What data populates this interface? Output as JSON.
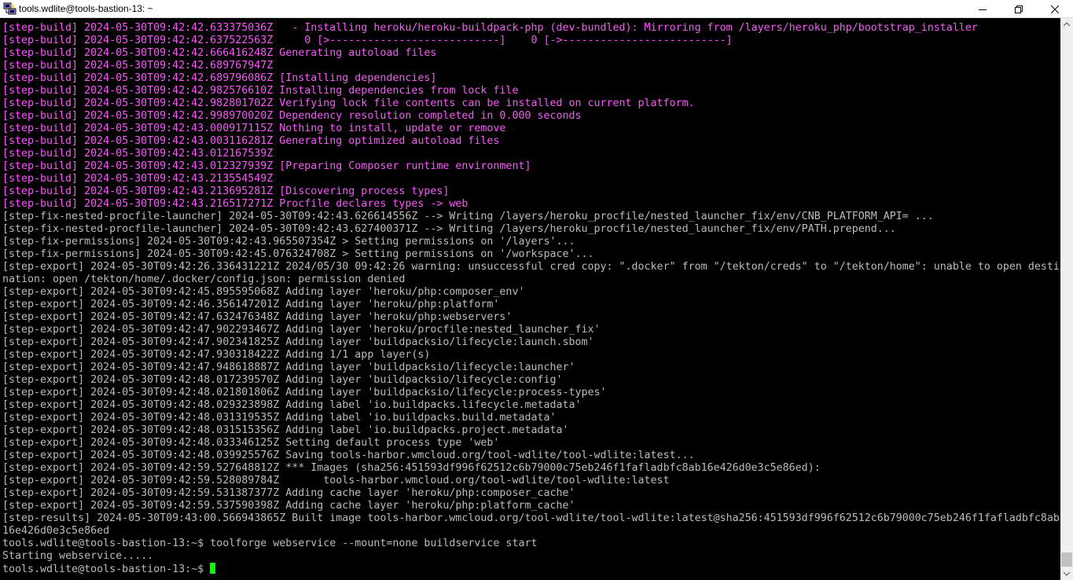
{
  "window": {
    "title": "tools.wdlite@tools-bastion-13: ~",
    "icons": {
      "app": "putty-icon",
      "minimize": "minimize-icon",
      "maximize": "maximize-icon",
      "close": "close-icon"
    }
  },
  "colors": {
    "background": "#000000",
    "text_default": "#bbbbbb",
    "text_magenta": "#ff55ff",
    "cursor": "#00ff00"
  },
  "terminal": {
    "lines": [
      {
        "text": "[step-build] 2024-05-30T09:42:42.633375036Z   - Installing heroku/heroku-buildpack-php (dev-bundled): Mirroring from /layers/heroku_php/bootstrap_installer",
        "color": "magenta"
      },
      {
        "text": "[step-build] 2024-05-30T09:42:42.637522563Z     0 [>---------------------------]    0 [->--------------------------]",
        "color": "magenta"
      },
      {
        "text": "[step-build] 2024-05-30T09:42:42.666416248Z Generating autoload files",
        "color": "magenta"
      },
      {
        "text": "[step-build] 2024-05-30T09:42:42.689767947Z",
        "color": "magenta"
      },
      {
        "text": "[step-build] 2024-05-30T09:42:42.689796086Z [Installing dependencies]",
        "color": "magenta"
      },
      {
        "text": "[step-build] 2024-05-30T09:42:42.982576610Z Installing dependencies from lock file",
        "color": "magenta"
      },
      {
        "text": "[step-build] 2024-05-30T09:42:42.982801702Z Verifying lock file contents can be installed on current platform.",
        "color": "magenta"
      },
      {
        "text": "[step-build] 2024-05-30T09:42:42.998970020Z Dependency resolution completed in 0.000 seconds",
        "color": "magenta"
      },
      {
        "text": "[step-build] 2024-05-30T09:42:43.000917115Z Nothing to install, update or remove",
        "color": "magenta"
      },
      {
        "text": "[step-build] 2024-05-30T09:42:43.003116281Z Generating optimized autoload files",
        "color": "magenta"
      },
      {
        "text": "[step-build] 2024-05-30T09:42:43.012167539Z",
        "color": "magenta"
      },
      {
        "text": "[step-build] 2024-05-30T09:42:43.012327939Z [Preparing Composer runtime environment]",
        "color": "magenta"
      },
      {
        "text": "[step-build] 2024-05-30T09:42:43.213554549Z",
        "color": "magenta"
      },
      {
        "text": "[step-build] 2024-05-30T09:42:43.213695281Z [Discovering process types]",
        "color": "magenta"
      },
      {
        "text": "[step-build] 2024-05-30T09:42:43.216517271Z Procfile declares types -> web",
        "color": "magenta"
      },
      {
        "text": "[step-fix-nested-procfile-launcher] 2024-05-30T09:42:43.626614556Z --> Writing /layers/heroku_procfile/nested_launcher_fix/env/CNB_PLATFORM_API= ...",
        "color": "default"
      },
      {
        "text": "[step-fix-nested-procfile-launcher] 2024-05-30T09:42:43.627400371Z --> Writing /layers/heroku_procfile/nested_launcher_fix/env/PATH.prepend...",
        "color": "default"
      },
      {
        "text": "[step-fix-permissions] 2024-05-30T09:42:43.965507354Z > Setting permissions on '/layers'...",
        "color": "default"
      },
      {
        "text": "[step-fix-permissions] 2024-05-30T09:42:45.076324708Z > Setting permissions on '/workspace'...",
        "color": "default"
      },
      {
        "text": "[step-export] 2024-05-30T09:42:26.336431221Z 2024/05/30 09:42:26 warning: unsuccessful cred copy: \".docker\" from \"/tekton/creds\" to \"/tekton/home\": unable to open desti",
        "color": "default"
      },
      {
        "text": "nation: open /tekton/home/.docker/config.json: permission denied",
        "color": "default"
      },
      {
        "text": "[step-export] 2024-05-30T09:42:45.895595068Z Adding layer 'heroku/php:composer_env'",
        "color": "default"
      },
      {
        "text": "[step-export] 2024-05-30T09:42:46.356147201Z Adding layer 'heroku/php:platform'",
        "color": "default"
      },
      {
        "text": "[step-export] 2024-05-30T09:42:47.632476348Z Adding layer 'heroku/php:webservers'",
        "color": "default"
      },
      {
        "text": "[step-export] 2024-05-30T09:42:47.902293467Z Adding layer 'heroku/procfile:nested_launcher_fix'",
        "color": "default"
      },
      {
        "text": "[step-export] 2024-05-30T09:42:47.902341825Z Adding layer 'buildpacksio/lifecycle:launch.sbom'",
        "color": "default"
      },
      {
        "text": "[step-export] 2024-05-30T09:42:47.930318422Z Adding 1/1 app layer(s)",
        "color": "default"
      },
      {
        "text": "[step-export] 2024-05-30T09:42:47.948618887Z Adding layer 'buildpacksio/lifecycle:launcher'",
        "color": "default"
      },
      {
        "text": "[step-export] 2024-05-30T09:42:48.017239570Z Adding layer 'buildpacksio/lifecycle:config'",
        "color": "default"
      },
      {
        "text": "[step-export] 2024-05-30T09:42:48.021801806Z Adding layer 'buildpacksio/lifecycle:process-types'",
        "color": "default"
      },
      {
        "text": "[step-export] 2024-05-30T09:42:48.029323898Z Adding label 'io.buildpacks.lifecycle.metadata'",
        "color": "default"
      },
      {
        "text": "[step-export] 2024-05-30T09:42:48.031319535Z Adding label 'io.buildpacks.build.metadata'",
        "color": "default"
      },
      {
        "text": "[step-export] 2024-05-30T09:42:48.031515356Z Adding label 'io.buildpacks.project.metadata'",
        "color": "default"
      },
      {
        "text": "[step-export] 2024-05-30T09:42:48.033346125Z Setting default process type 'web'",
        "color": "default"
      },
      {
        "text": "[step-export] 2024-05-30T09:42:48.039925576Z Saving tools-harbor.wmcloud.org/tool-wdlite/tool-wdlite:latest...",
        "color": "default"
      },
      {
        "text": "[step-export] 2024-05-30T09:42:59.527648812Z *** Images (sha256:451593df996f62512c6b79000c75eb246f1fafladbfc8ab16e426d0e3c5e86ed):",
        "color": "default"
      },
      {
        "text": "[step-export] 2024-05-30T09:42:59.528089784Z       tools-harbor.wmcloud.org/tool-wdlite/tool-wdlite:latest",
        "color": "default"
      },
      {
        "text": "[step-export] 2024-05-30T09:42:59.531387377Z Adding cache layer 'heroku/php:composer_cache'",
        "color": "default"
      },
      {
        "text": "[step-export] 2024-05-30T09:42:59.537590398Z Adding cache layer 'heroku/php:platform_cache'",
        "color": "default"
      },
      {
        "text": "[step-results] 2024-05-30T09:43:00.566943865Z Built image tools-harbor.wmcloud.org/tool-wdlite/tool-wdlite:latest@sha256:451593df996f62512c6b79000c75eb246f1fafladbfc8ab",
        "color": "default"
      },
      {
        "text": "16e426d0e3c5e86ed",
        "color": "default"
      },
      {
        "text": "tools.wdlite@tools-bastion-13:~$ toolforge webservice --mount=none buildservice start",
        "color": "default"
      },
      {
        "text": "Starting webservice.....",
        "color": "default"
      }
    ],
    "prompt": "tools.wdlite@tools-bastion-13:~$ "
  }
}
